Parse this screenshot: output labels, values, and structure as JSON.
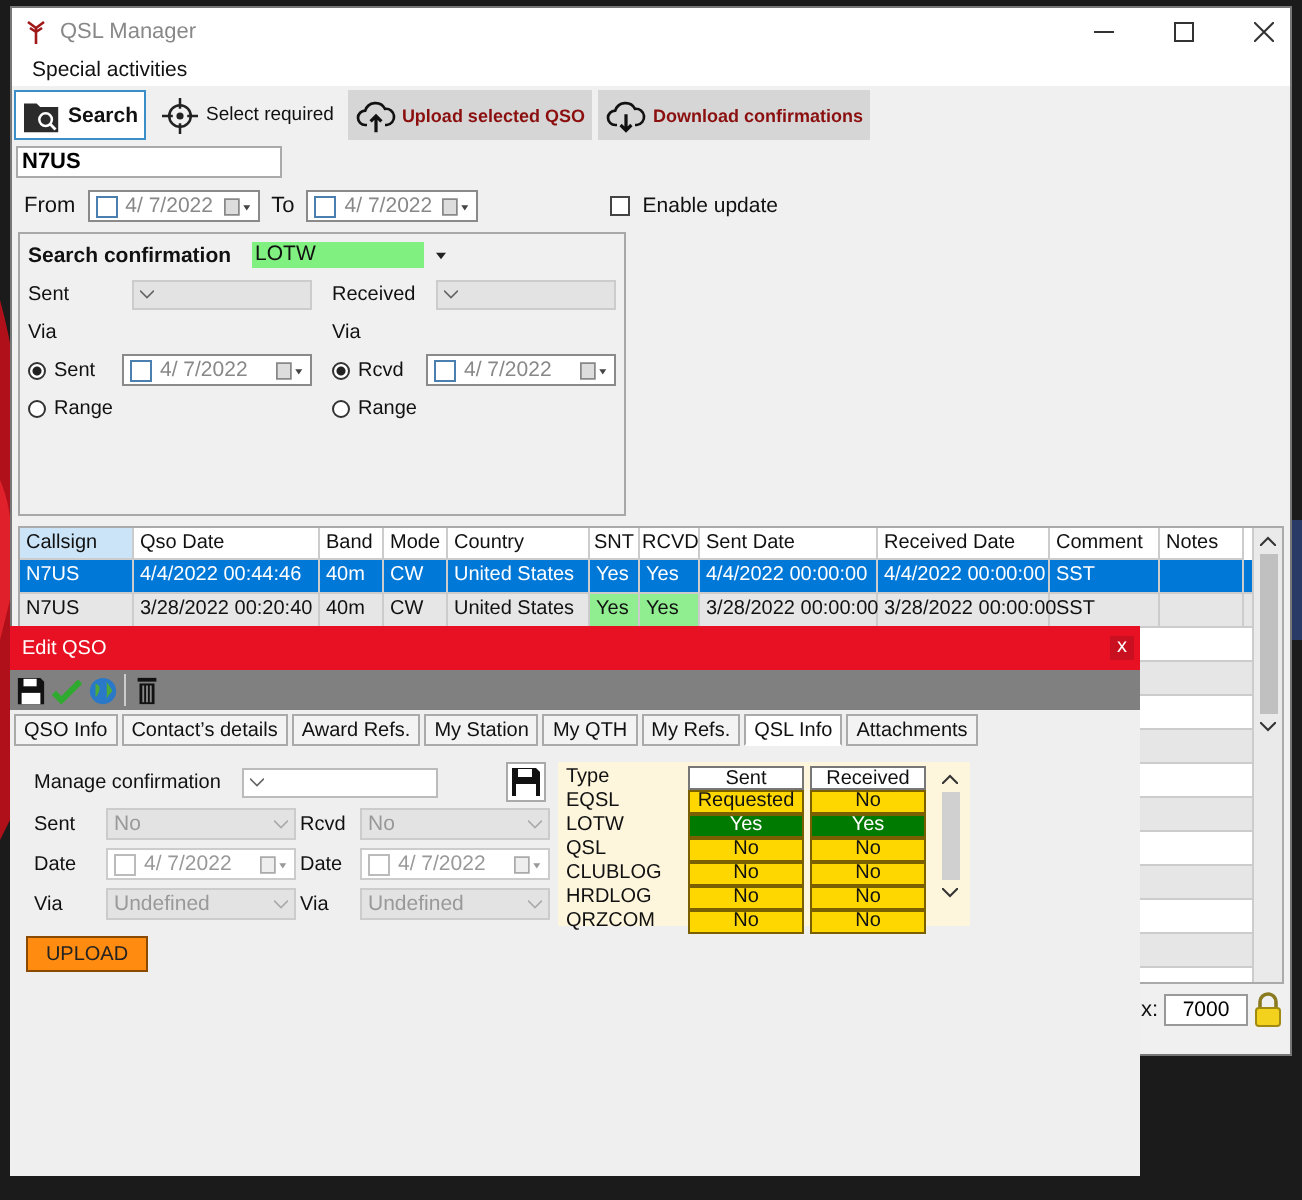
{
  "window": {
    "title": "QSL Manager"
  },
  "menu": [
    "Special activities"
  ],
  "toolbar": [
    {
      "label": "Search",
      "kind": "search",
      "selected": true
    },
    {
      "label": "Select required",
      "kind": "target",
      "selected": false
    },
    {
      "label": "Upload selected QSO",
      "kind": "upload",
      "selected": false
    },
    {
      "label": "Download confirmations",
      "kind": "download",
      "selected": false
    }
  ],
  "callsign": {
    "value": "N7US"
  },
  "period": {
    "from_label": "From",
    "from": "4/ 7/2022",
    "to_label": "To",
    "to": "4/ 7/2022"
  },
  "enable_update": {
    "label": "Enable update",
    "checked": false
  },
  "search_confirmation": {
    "label": "Search confirmation",
    "value": "LOTW",
    "sides": [
      {
        "label": "Sent",
        "via_label": "Via",
        "date": "4/ 7/2022",
        "options": [
          {
            "label": "Sent",
            "selected": true
          },
          {
            "label": "Range",
            "selected": false
          }
        ]
      },
      {
        "label": "Received",
        "via_label": "Via",
        "date": "4/ 7/2022",
        "options": [
          {
            "label": "Rcvd",
            "selected": true
          },
          {
            "label": "Range",
            "selected": false
          }
        ]
      }
    ]
  },
  "table": {
    "columns": [
      {
        "label": "Callsign",
        "kind": "text",
        "sorted": true
      },
      {
        "label": "Qso Date",
        "kind": "text",
        "sorted": false
      },
      {
        "label": "Band",
        "kind": "text",
        "sorted": false
      },
      {
        "label": "Mode",
        "kind": "text",
        "sorted": false
      },
      {
        "label": "Country",
        "kind": "text",
        "sorted": false
      },
      {
        "label": "SNT",
        "kind": "status",
        "sorted": false
      },
      {
        "label": "RCVD",
        "kind": "status",
        "sorted": false
      },
      {
        "label": "Sent Date",
        "kind": "text",
        "sorted": false
      },
      {
        "label": "Received Date",
        "kind": "text",
        "sorted": false
      },
      {
        "label": "Comment",
        "kind": "text",
        "sorted": false
      },
      {
        "label": "Notes",
        "kind": "text",
        "sorted": false
      }
    ],
    "rows": [
      {
        "selected": true,
        "confirmed": false,
        "cells": [
          "N7US",
          "4/4/2022 00:44:46",
          "40m",
          "CW",
          "United States",
          "Yes",
          "Yes",
          "4/4/2022 00:00:00",
          "4/4/2022 00:00:00",
          "SST"
        ]
      },
      {
        "selected": false,
        "confirmed": true,
        "cells": [
          "N7US",
          "3/28/2022 00:20:40",
          "40m",
          "CW",
          "United States",
          "Yes",
          "Yes",
          "3/28/2022 00:00:00",
          "3/28/2022 00:00:00",
          "SST"
        ]
      }
    ]
  },
  "max": {
    "label": "x:",
    "value": "7000"
  },
  "edit_dialog": {
    "title": "Edit QSO",
    "close": "x",
    "tabs": [
      {
        "label": "QSO Info",
        "selected": false
      },
      {
        "label": "Contact’s details",
        "selected": false
      },
      {
        "label": "Award Refs.",
        "selected": false
      },
      {
        "label": "My Station",
        "selected": false
      },
      {
        "label": "My QTH",
        "selected": false
      },
      {
        "label": "My Refs.",
        "selected": false
      },
      {
        "label": "QSL Info",
        "selected": true
      },
      {
        "label": "Attachments",
        "selected": false
      }
    ],
    "manage_label": "Manage confirmation",
    "disabled": true,
    "sides": [
      {
        "status_label": "Sent",
        "status": "No",
        "date_label": "Date",
        "date": "4/ 7/2022",
        "via_label": "Via",
        "via": "Undefined"
      },
      {
        "status_label": "Rcvd",
        "status": "No",
        "date_label": "Date",
        "date": "4/ 7/2022",
        "via_label": "Via",
        "via": "Undefined"
      }
    ],
    "upload_button": "UPLOAD",
    "qsl_table": {
      "columns": [
        "Type",
        "Sent",
        "Received"
      ],
      "rows": [
        {
          "type": "EQSL",
          "sent": {
            "text": "Requested",
            "confirmed": false
          },
          "received": {
            "text": "No",
            "confirmed": false
          }
        },
        {
          "type": "LOTW",
          "sent": {
            "text": "Yes",
            "confirmed": true
          },
          "received": {
            "text": "Yes",
            "confirmed": true
          }
        },
        {
          "type": "QSL",
          "sent": {
            "text": "No",
            "confirmed": false
          },
          "received": {
            "text": "No",
            "confirmed": false
          }
        },
        {
          "type": "CLUBLOG",
          "sent": {
            "text": "No",
            "confirmed": false
          },
          "received": {
            "text": "No",
            "confirmed": false
          }
        },
        {
          "type": "HRDLOG",
          "sent": {
            "text": "No",
            "confirmed": false
          },
          "received": {
            "text": "No",
            "confirmed": false
          }
        },
        {
          "type": "QRZCOM",
          "sent": {
            "text": "No",
            "confirmed": false
          },
          "received": {
            "text": "No",
            "confirmed": false
          }
        }
      ]
    }
  }
}
